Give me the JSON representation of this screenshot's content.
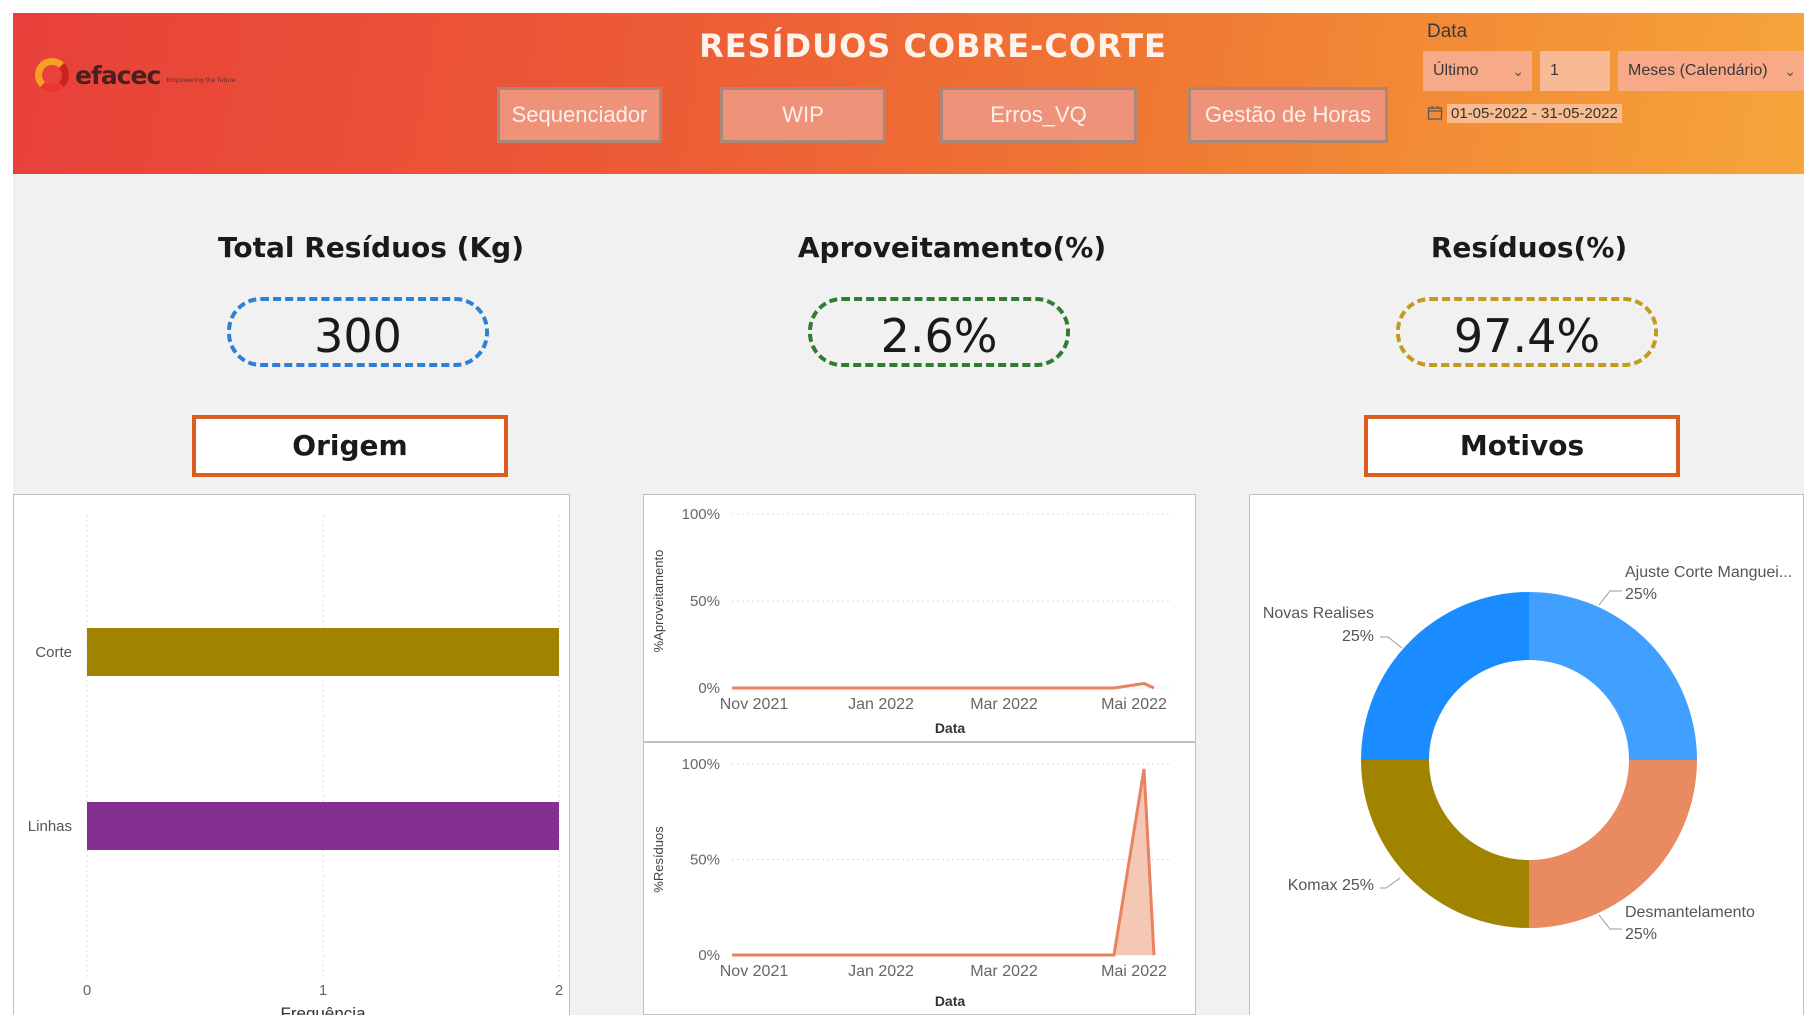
{
  "header": {
    "logo_text": "efacec",
    "logo_tagline": "Empowering the future",
    "title": "RESÍDUOS COBRE-CORTE",
    "nav": [
      "Sequenciador",
      "WIP",
      "Erros_VQ",
      "Gestão de Horas"
    ]
  },
  "slicer": {
    "label": "Data",
    "mode": "Último",
    "count": "1",
    "unit": "Meses (Calendário)",
    "range": "01-05-2022 - 31-05-2022",
    "icons": {
      "calendar": "calendar-icon",
      "dropdown": "chevron-down-icon"
    }
  },
  "kpis": {
    "total": {
      "title": "Total Resíduos (Kg)",
      "value": "300",
      "color": "#2f7fd6"
    },
    "aproveitamento": {
      "title": "Aproveitamento(%)",
      "value": "2.6%",
      "color": "#2e7d32"
    },
    "residuos": {
      "title": "Resíduos(%)",
      "value": "97.4%",
      "color": "#c49a1c"
    }
  },
  "sections": {
    "origem": "Origem",
    "motivos": "Motivos"
  },
  "colors": {
    "accent": "#dc5d1e",
    "line": "#e8825f"
  },
  "chart_data": [
    {
      "type": "bar",
      "orientation": "horizontal",
      "categories": [
        "Corte",
        "Linhas"
      ],
      "values": [
        2,
        2
      ],
      "colors": [
        "#a08400",
        "#852f93"
      ],
      "xlabel": "Frequência",
      "ylabel": "",
      "xlim": [
        0,
        2
      ],
      "xticks": [
        "0",
        "1",
        "2"
      ],
      "grid": true
    },
    {
      "type": "line",
      "x": [
        "Nov 2021",
        "Jan 2022",
        "Mar 2022",
        "Mai 2022"
      ],
      "xticks": [
        "Nov 2021",
        "Jan 2022",
        "Mar 2022",
        "Mai 2022"
      ],
      "series": [
        {
          "values": [
            0,
            0,
            0,
            0,
            0,
            0,
            0.026,
            0
          ]
        }
      ],
      "xlabel": "Data",
      "ylabel": "%Aproveitamento",
      "yticks": [
        "100%",
        "50%",
        "0%"
      ],
      "ylim": [
        0,
        1
      ]
    },
    {
      "type": "area",
      "x": [
        "Nov 2021",
        "Jan 2022",
        "Mar 2022",
        "Mai 2022"
      ],
      "xticks": [
        "Nov 2021",
        "Jan 2022",
        "Mar 2022",
        "Mai 2022"
      ],
      "series": [
        {
          "values": [
            0,
            0,
            0,
            0,
            0,
            0,
            0.974,
            0
          ]
        }
      ],
      "xlabel": "Data",
      "ylabel": "%Resíduos",
      "yticks": [
        "100%",
        "50%",
        "0%"
      ],
      "ylim": [
        0,
        1
      ]
    },
    {
      "type": "pie",
      "donut": true,
      "slices": [
        {
          "label": "Ajuste Corte Manguei...",
          "pct": "25%",
          "value": 25,
          "color": "#41a0ff"
        },
        {
          "label": "Desmantelamento",
          "pct": "25%",
          "value": 25,
          "color": "#ea8a61"
        },
        {
          "label": "Komax",
          "pct": "25%",
          "value": 25,
          "color": "#a08400"
        },
        {
          "label": "Novas Realises",
          "pct": "25%",
          "value": 25,
          "color": "#1a8cff"
        }
      ]
    }
  ]
}
